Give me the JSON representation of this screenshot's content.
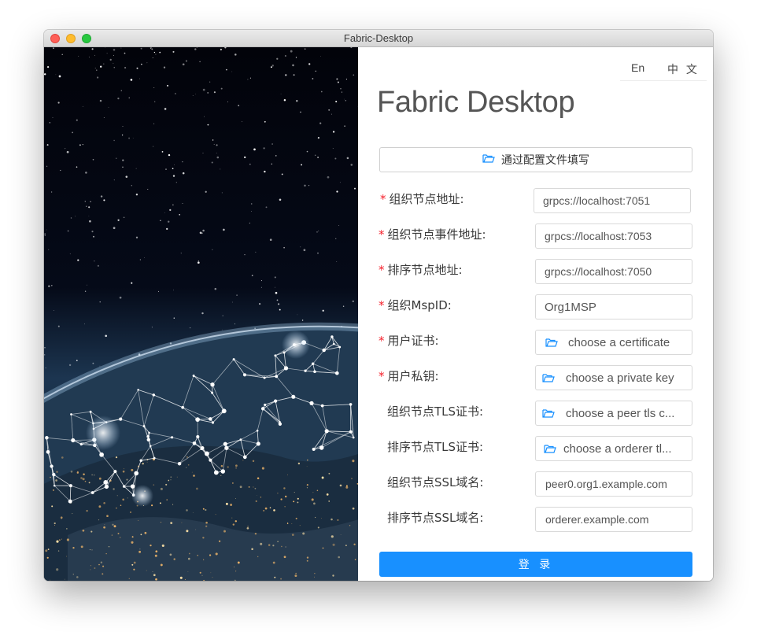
{
  "window": {
    "title": "Fabric-Desktop"
  },
  "lang": {
    "en": "En",
    "zh": "中 文"
  },
  "app": {
    "title": "Fabric Desktop"
  },
  "config_button": {
    "label": "通过配置文件填写",
    "icon": "folder-open-icon"
  },
  "form": {
    "peer_address": {
      "label": "组织节点地址:",
      "required": true,
      "value": "grpcs://localhost:7051"
    },
    "peer_event_address": {
      "label": "组织节点事件地址:",
      "required": true,
      "value": "grpcs://localhost:7053"
    },
    "orderer_address": {
      "label": "排序节点地址:",
      "required": true,
      "value": "grpcs://localhost:7050"
    },
    "msp_id": {
      "label": "组织MspID:",
      "required": true,
      "value": "Org1MSP"
    },
    "user_cert": {
      "label": "用户证书:",
      "required": true,
      "value": "choose a certificate"
    },
    "user_key": {
      "label": "用户私钥:",
      "required": true,
      "value": "choose a private key"
    },
    "peer_tls_cert": {
      "label": "组织节点TLS证书:",
      "required": false,
      "value": "choose a peer tls c..."
    },
    "orderer_tls_cert": {
      "label": "排序节点TLS证书:",
      "required": false,
      "value": "choose a orderer tl..."
    },
    "peer_ssl_domain": {
      "label": "组织节点SSL域名:",
      "required": false,
      "value": "peer0.org1.example.com"
    },
    "orderer_ssl_domain": {
      "label": "排序节点SSL域名:",
      "required": false,
      "value": "orderer.example.com"
    }
  },
  "required_mark": "*",
  "login_button": {
    "label": "登 录"
  },
  "colors": {
    "primary": "#1890ff",
    "required": "#f5222d",
    "icon": "#1890ff"
  }
}
